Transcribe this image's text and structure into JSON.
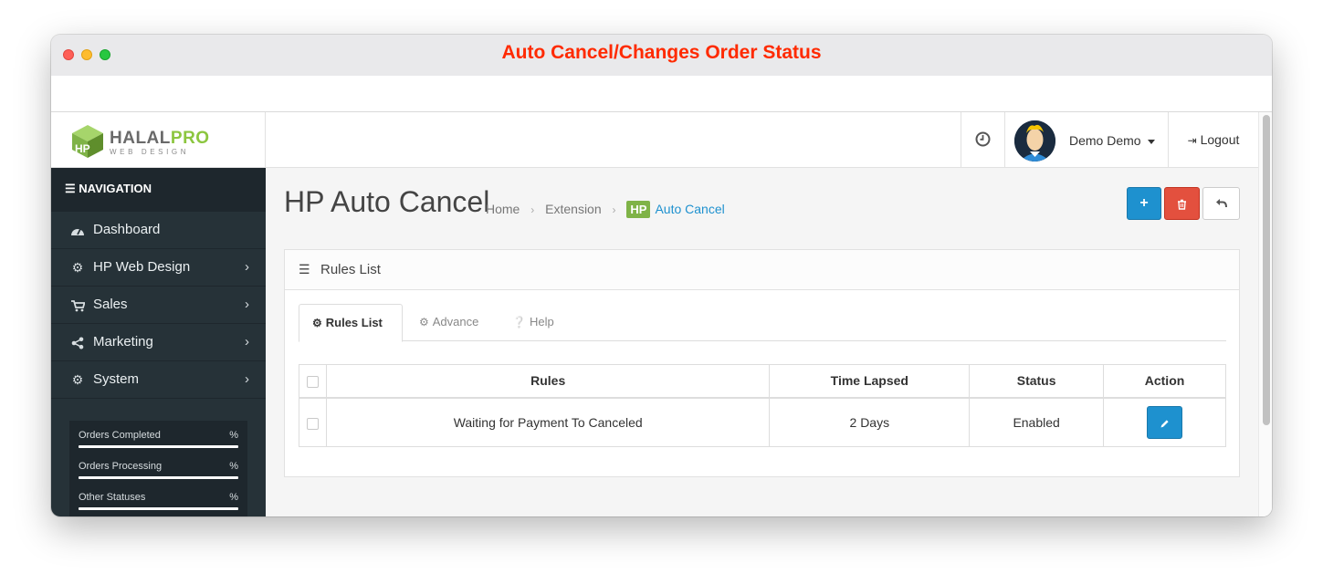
{
  "window": {
    "title": "Auto Cancel/Changes Order Status"
  },
  "header": {
    "logo": {
      "name_part1": "HALAL",
      "name_part2": "PRO",
      "subtitle": "WEB DESIGN"
    },
    "clock_icon": "clock-icon",
    "user": {
      "name": "Demo Demo"
    },
    "logout_label": "Logout",
    "logout_icon": "sign-out-icon"
  },
  "sidebar": {
    "nav_title": "NAVIGATION",
    "items": [
      {
        "label": "Dashboard",
        "icon": "tachometer-icon",
        "has_children": false
      },
      {
        "label": "HP Web Design",
        "icon": "cogs-icon",
        "has_children": true
      },
      {
        "label": "Sales",
        "icon": "shopping-cart-icon",
        "has_children": true
      },
      {
        "label": "Marketing",
        "icon": "share-icon",
        "has_children": true
      },
      {
        "label": "System",
        "icon": "cog-icon",
        "has_children": true
      }
    ],
    "stats": [
      {
        "label": "Orders Completed",
        "value": "%"
      },
      {
        "label": "Orders Processing",
        "value": "%"
      },
      {
        "label": "Other Statuses",
        "value": "%"
      }
    ]
  },
  "page": {
    "title": "HP Auto Cancel",
    "breadcrumb": {
      "home": "Home",
      "extension": "Extension",
      "badge": "HP",
      "current": "Auto Cancel"
    },
    "buttons": {
      "add": "+",
      "delete_icon": "trash-icon",
      "back_icon": "reply-icon"
    }
  },
  "panel": {
    "title": "Rules List",
    "tabs": [
      {
        "label": "Rules List",
        "icon": "cog-icon",
        "active": true
      },
      {
        "label": "Advance",
        "icon": "cogs-icon",
        "active": false
      },
      {
        "label": "Help",
        "icon": "question-circle-icon",
        "active": false
      }
    ],
    "table": {
      "headers": [
        "Rules",
        "Time Lapsed",
        "Status",
        "Action"
      ],
      "rows": [
        {
          "rule": "Waiting for Payment To Canceled",
          "time_lapsed": "2 Days",
          "status": "Enabled"
        }
      ]
    }
  },
  "colors": {
    "title_red": "#ff2a00",
    "sidebar_bg": "#263238",
    "primary_blue": "#1e91cf",
    "danger_red": "#e3503e",
    "brand_green": "#8cc63f"
  }
}
